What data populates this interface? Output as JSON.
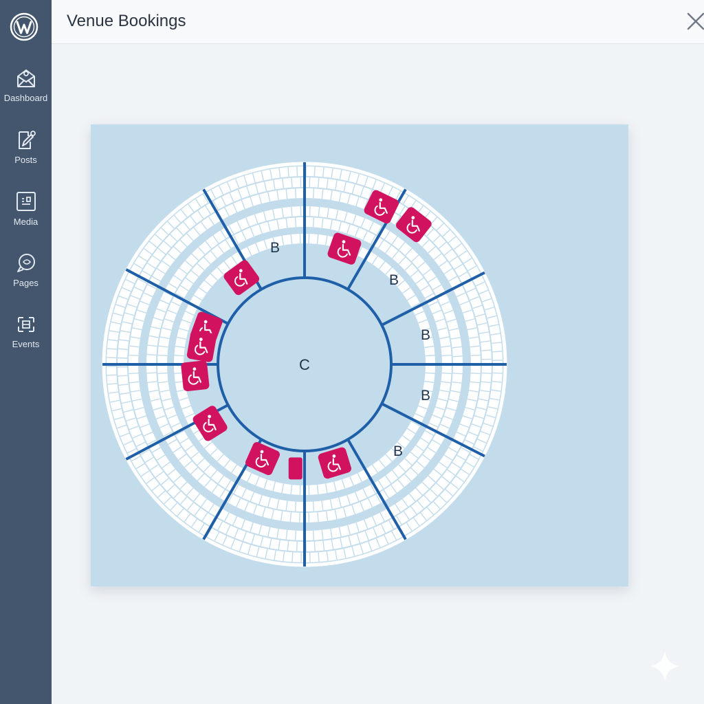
{
  "app": {
    "title": "Venue Bookings"
  },
  "sidebar": {
    "logo_icon": "wordpress-logo-icon",
    "items": [
      {
        "label": "Dashboard",
        "icon": "dashboard-icon"
      },
      {
        "label": "Posts",
        "icon": "posts-icon"
      },
      {
        "label": "Media",
        "icon": "media-icon"
      },
      {
        "label": "Pages",
        "icon": "pages-icon"
      },
      {
        "label": "Events",
        "icon": "events-icon"
      }
    ]
  },
  "header": {
    "close_icon": "close-icon"
  },
  "seat_map": {
    "center_label": "C",
    "section_labels": [
      "B",
      "B",
      "B",
      "B",
      "B"
    ],
    "accessible_icon": "wheelchair-icon",
    "colors": {
      "background": "#c2dcec",
      "divider": "#1f5fa8",
      "accessible_seat": "#d1135f",
      "seat": "#ffffff"
    }
  }
}
